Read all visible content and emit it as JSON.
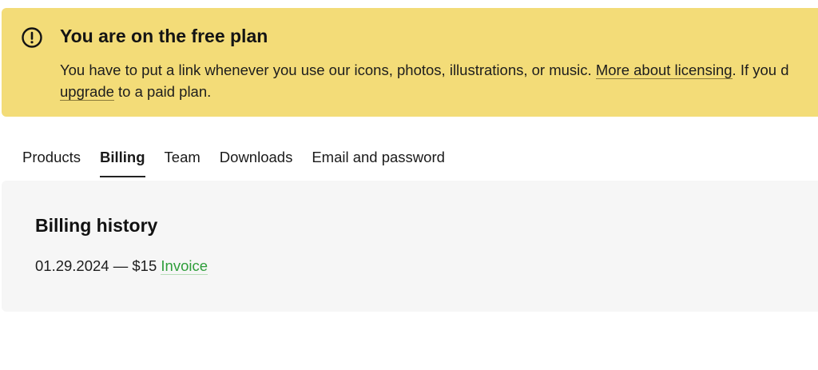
{
  "banner": {
    "icon": "exclamation-circle-icon",
    "title": "You are on the free plan",
    "text_before_link": "You have to put a link whenever you use our icons, photos, illustrations, or music. ",
    "licensing_link": "More about licensing",
    "text_after_link": ". If you d",
    "upgrade_link": "upgrade",
    "text_end": " to a paid plan."
  },
  "tabs": [
    {
      "label": "Products"
    },
    {
      "label": "Billing",
      "active": true
    },
    {
      "label": "Team"
    },
    {
      "label": "Downloads"
    },
    {
      "label": "Email and password"
    }
  ],
  "billing": {
    "title": "Billing history",
    "entries": [
      {
        "date": "01.29.2024",
        "separator": " — ",
        "amount": "$15",
        "invoice_label": "Invoice"
      }
    ]
  },
  "colors": {
    "banner_bg": "#f3dc78",
    "panel_bg": "#f6f6f6",
    "invoice_link": "#2f9e3b"
  }
}
